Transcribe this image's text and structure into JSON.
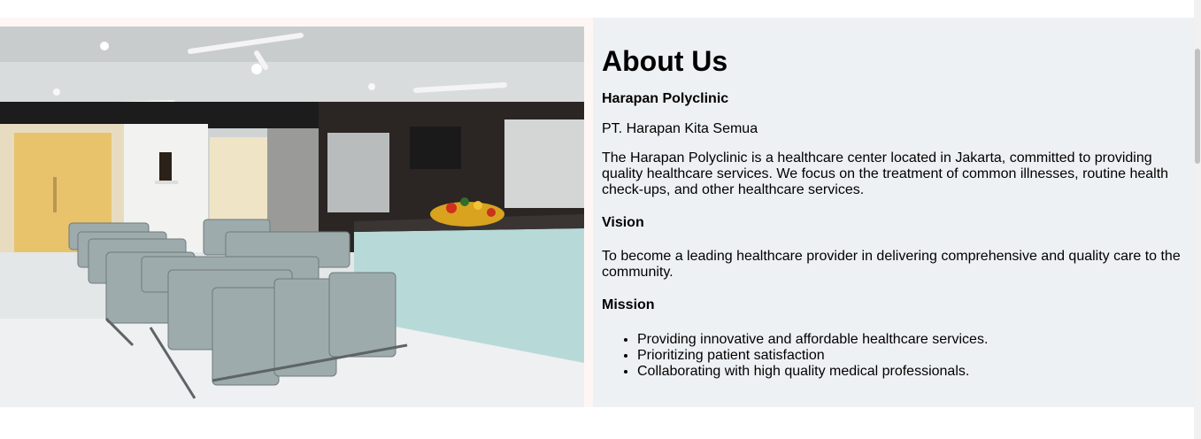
{
  "about": {
    "title": "About Us",
    "clinic_name": "Harapan Polyclinic",
    "company": "PT. Harapan Kita Semua",
    "description": "The Harapan Polyclinic is a healthcare center located in Jakarta, committed to providing quality healthcare services. We focus on the treatment of common illnesses, routine health check-ups, and other healthcare services.",
    "vision_heading": "Vision",
    "vision_text": "To become a leading healthcare provider in delivering comprehensive and quality care to the community.",
    "mission_heading": "Mission",
    "mission_items": [
      "Providing innovative and affordable healthcare services.",
      "Prioritizing patient satisfaction",
      "Collaborating with high quality medical professionals."
    ]
  },
  "colors": {
    "panel_background": "#eef1f4",
    "page_background": "#ffffff",
    "band_background": "#fdf6f4"
  },
  "image": {
    "subject": "clinic waiting room with grey seats, reception desk, flowers and wall-mounted TV"
  }
}
